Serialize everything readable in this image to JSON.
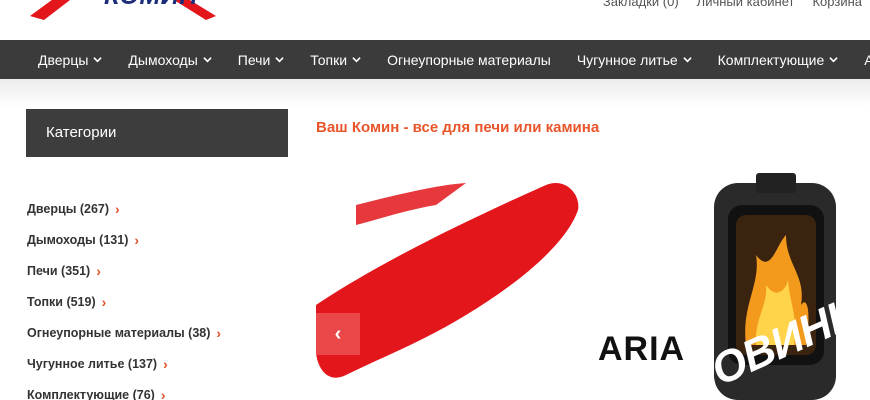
{
  "header": {
    "logo_text": "КОМИН",
    "links": [
      "Закладки (0)",
      "Личный кабинет",
      "Корзина"
    ]
  },
  "nav": {
    "items": [
      {
        "label": "Дверцы",
        "has_dropdown": true
      },
      {
        "label": "Дымоходы",
        "has_dropdown": true
      },
      {
        "label": "Печи",
        "has_dropdown": true
      },
      {
        "label": "Топки",
        "has_dropdown": true
      },
      {
        "label": "Огнеупорные материалы",
        "has_dropdown": false
      },
      {
        "label": "Чугунное литье",
        "has_dropdown": true
      },
      {
        "label": "Комплектующие",
        "has_dropdown": true
      },
      {
        "label": "А",
        "has_dropdown": false
      }
    ]
  },
  "sidebar": {
    "title": "Категории",
    "items": [
      {
        "label": "Дверцы (267)"
      },
      {
        "label": "Дымоходы (131)"
      },
      {
        "label": "Печи (351)"
      },
      {
        "label": "Топки (519)"
      },
      {
        "label": "Огнеупорные материалы (38)"
      },
      {
        "label": "Чугунное литье (137)"
      },
      {
        "label": "Комплектующие (76)"
      }
    ]
  },
  "main": {
    "title": "Ваш Комин - все для печи или камина",
    "slide": {
      "promo": "НОВИНКА",
      "model": "ARIA"
    }
  },
  "colors": {
    "accent": "#e8552b",
    "nav_bg": "#3b3b3b",
    "brand_red": "#e3161b",
    "logo_blue": "#1c2d7a"
  }
}
